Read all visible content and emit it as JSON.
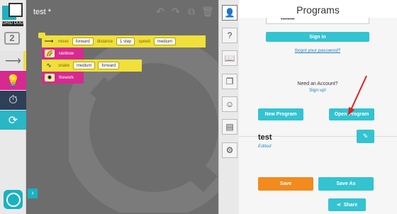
{
  "palette": {
    "logo_label": "GRID DUO",
    "level": "2",
    "categories": [
      {
        "name": "motion",
        "icon": "arrow-right-icon",
        "color": "#f1e03a"
      },
      {
        "name": "lights",
        "icon": "bulb-icon",
        "color": "#d62a90"
      },
      {
        "name": "time",
        "icon": "timer-icon",
        "color": "#2e3f58"
      },
      {
        "name": "loops",
        "icon": "repeat-icon",
        "color": "#29b6c5"
      }
    ]
  },
  "canvas": {
    "document_title": "test *",
    "blocks": {
      "move": {
        "label": "move",
        "direction": "forward",
        "distance_label": "distance",
        "distance": "1 step",
        "speed_label": "speed",
        "speed": "medium"
      },
      "rainbow": {
        "label": "rainbow"
      },
      "snake": {
        "label": "snake",
        "speed": "medium",
        "direction": "forward"
      },
      "firework": {
        "label": "firework"
      }
    }
  },
  "panel": {
    "title": "Programs",
    "password_mask": "••••••••",
    "sign_in": "Sign in",
    "forgot_password": "forgot your password?",
    "need_account": "Need an Account?",
    "sign_up": "Sign up!",
    "new_program": "New Program",
    "open_program": "Open Program",
    "program_name": "test",
    "program_status": "Edited",
    "save": "Save",
    "save_as": "Save As",
    "share": "Share"
  },
  "colors": {
    "accent": "#33c3d1",
    "save": "#f28a1d"
  }
}
